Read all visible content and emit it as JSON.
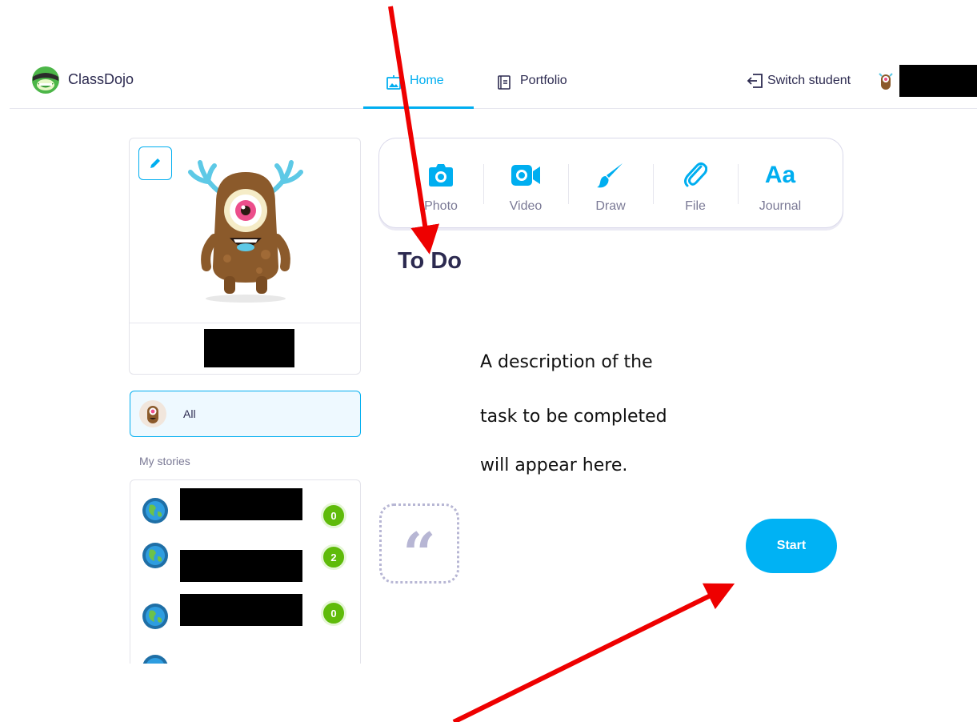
{
  "header": {
    "brand": "ClassDojo",
    "tabs": [
      {
        "label": "Home",
        "active": true
      },
      {
        "label": "Portfolio",
        "active": false
      }
    ],
    "switch_student_label": "Switch student"
  },
  "filter": {
    "all_label": "All",
    "stories_heading": "My stories"
  },
  "stories": [
    {
      "badge": "0"
    },
    {
      "badge": "2"
    },
    {
      "badge": "0"
    }
  ],
  "toolbar": {
    "items": [
      {
        "label": "Photo",
        "icon": "camera-icon"
      },
      {
        "label": "Video",
        "icon": "video-camera-icon"
      },
      {
        "label": "Draw",
        "icon": "brush-icon"
      },
      {
        "label": "File",
        "icon": "paperclip-icon"
      },
      {
        "label": "Journal",
        "icon": "aa-text-icon",
        "glyph": "Aa"
      }
    ]
  },
  "todo": {
    "heading": "To Do",
    "description_lines": [
      "A description of the",
      "task to be completed",
      "will appear here."
    ],
    "quote_glyph": "“",
    "start_label": "Start"
  },
  "colors": {
    "accent": "#00aef0",
    "text": "#2c2a50",
    "muted": "#7b7a96",
    "badge": "#5fbb0a",
    "annotation_arrow": "#ee0000"
  }
}
